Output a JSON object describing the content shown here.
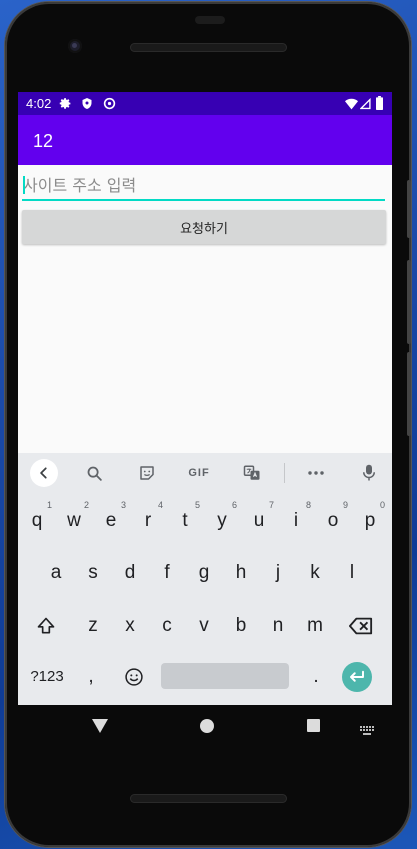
{
  "status": {
    "time": "4:02"
  },
  "app": {
    "title": "12"
  },
  "form": {
    "url_placeholder": "사이트 주소 입력",
    "url_value": "",
    "request_label": "요청하기"
  },
  "keyboard": {
    "toolbar": {
      "gif_label": "GIF"
    },
    "row1": [
      {
        "key": "q",
        "hint": "1"
      },
      {
        "key": "w",
        "hint": "2"
      },
      {
        "key": "e",
        "hint": "3"
      },
      {
        "key": "r",
        "hint": "4"
      },
      {
        "key": "t",
        "hint": "5"
      },
      {
        "key": "y",
        "hint": "6"
      },
      {
        "key": "u",
        "hint": "7"
      },
      {
        "key": "i",
        "hint": "8"
      },
      {
        "key": "o",
        "hint": "9"
      },
      {
        "key": "p",
        "hint": "0"
      }
    ],
    "row2": [
      "a",
      "s",
      "d",
      "f",
      "g",
      "h",
      "j",
      "k",
      "l"
    ],
    "row3": [
      "z",
      "x",
      "c",
      "v",
      "b",
      "n",
      "m"
    ],
    "row4": {
      "symbols": "?123",
      "comma": ",",
      "period": "."
    },
    "colors": {
      "enter": "#4db6ac",
      "background": "#e8eaed"
    }
  },
  "colors": {
    "status_bar": "#3700b3",
    "app_bar": "#6200ee",
    "accent": "#03dac5"
  }
}
